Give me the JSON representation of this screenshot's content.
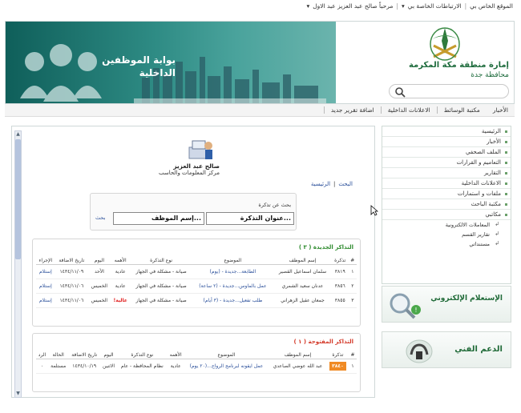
{
  "topbar": {
    "greeting": "مرحباً صالح عبد العزيز عبد الاول",
    "links_menu": "الارتباطات الخاصة بي",
    "my_site": "الموقع الخاص بي"
  },
  "header": {
    "portal_title_line1": "بوابة الموظفين",
    "portal_title_line2": "الداخلية",
    "org_line1": "إمارة منطقة مكة المكرمة",
    "org_line2": "محافظة جدة",
    "search_placeholder": ""
  },
  "nav": {
    "items": [
      "الأخبار",
      "مكتبة الوسائط",
      "الاعلانات الداخلية",
      "اضافة تقرير جديد"
    ]
  },
  "sidebar": {
    "items": [
      "الرئيسية",
      "الأخبار",
      "الملف الصحفي",
      "التعاميم و القرارات",
      "التقارير",
      "الاعلانات الداخلية",
      "ملفات و استمارات",
      "مكتبة الباحث",
      "مكاتبي"
    ],
    "subitems": [
      "المعاملات الالكترونية",
      "تقارير القسم",
      "مستنداتي"
    ]
  },
  "promos": {
    "inquiry": "الإستعلام الإلكتروني",
    "support": "الدعم الفني"
  },
  "profile": {
    "name": "صالح عبد العزيز",
    "dept": "مركز المعلومات والحاسب"
  },
  "breadcrumb": {
    "home": "الرئيسية",
    "search": "البحث"
  },
  "search": {
    "label": "بحث عن تذكرة",
    "ticket_placeholder": "عنوان التذكرة...",
    "employee_placeholder": "إسم الموظف...",
    "button": "بحث"
  },
  "new_tickets": {
    "title": "التذاكر الجديدة ( ٣ )",
    "headers": [
      "#",
      "تذكرة",
      "إسم الموظف",
      "الموضوع",
      "نوع التذكرة",
      "الأهمه",
      "اليوم",
      "تاريخ الاضافة",
      "الإجراء"
    ],
    "rows": [
      {
        "n": "١",
        "ticket": "٣٨١٩",
        "employee": "سلمان اسماعيل القصير",
        "subject": "الطابعة...جديدة - (يوم)",
        "type": "صيانة - مشكلة في الجهاز",
        "priority": "عادية",
        "day": "الأحد",
        "date": "١٤٣٤/١١/٠٩",
        "action": "إستلام"
      },
      {
        "n": "٢",
        "ticket": "٣٨٥٦",
        "employee": "عدنان سعيد الشمري",
        "subject": "عمل بالماوس...جديدة - (٢ ساعة)",
        "type": "صيانة - مشكلة في الجهاز",
        "priority": "عادية",
        "day": "الخميس",
        "date": "١٤٣٤/١١/٠٦",
        "action": "إستلام"
      },
      {
        "n": "٣",
        "ticket": "٣٨٥٥",
        "employee": "جمعان عقيل الزهراني",
        "subject": "طلب تفعيل...جديدة - (٣ أيام)",
        "type": "صيانة - مشكلة في الجهاز",
        "priority": "عالية!",
        "day": "الخميس",
        "date": "١٤٣٤/١١/٠٦",
        "action": "إستلام"
      }
    ]
  },
  "open_tickets": {
    "title": "التذاكر المفتوحة ( ١ )",
    "headers": [
      "#",
      "تذكرة",
      "إسم الموظف",
      "الموضوع",
      "الأهمه",
      "نوع التذكرة",
      "اليوم",
      "تاريخ الاضافة",
      "الحالة",
      "الرد"
    ],
    "rows": [
      {
        "n": "١",
        "ticket": "٣٨٤٠",
        "employee": "عبد الله عوضي الصاعدي",
        "subject": "عمل ايقونه لبرنامج الرواج...(٢٠ يوم)",
        "priority": "عادية",
        "type": "نظام المحافظة - عام",
        "day": "الاثنين",
        "date": "١٤٣٤/١٠/١٩",
        "status": "مستلمة",
        "reply": "٠"
      }
    ]
  }
}
